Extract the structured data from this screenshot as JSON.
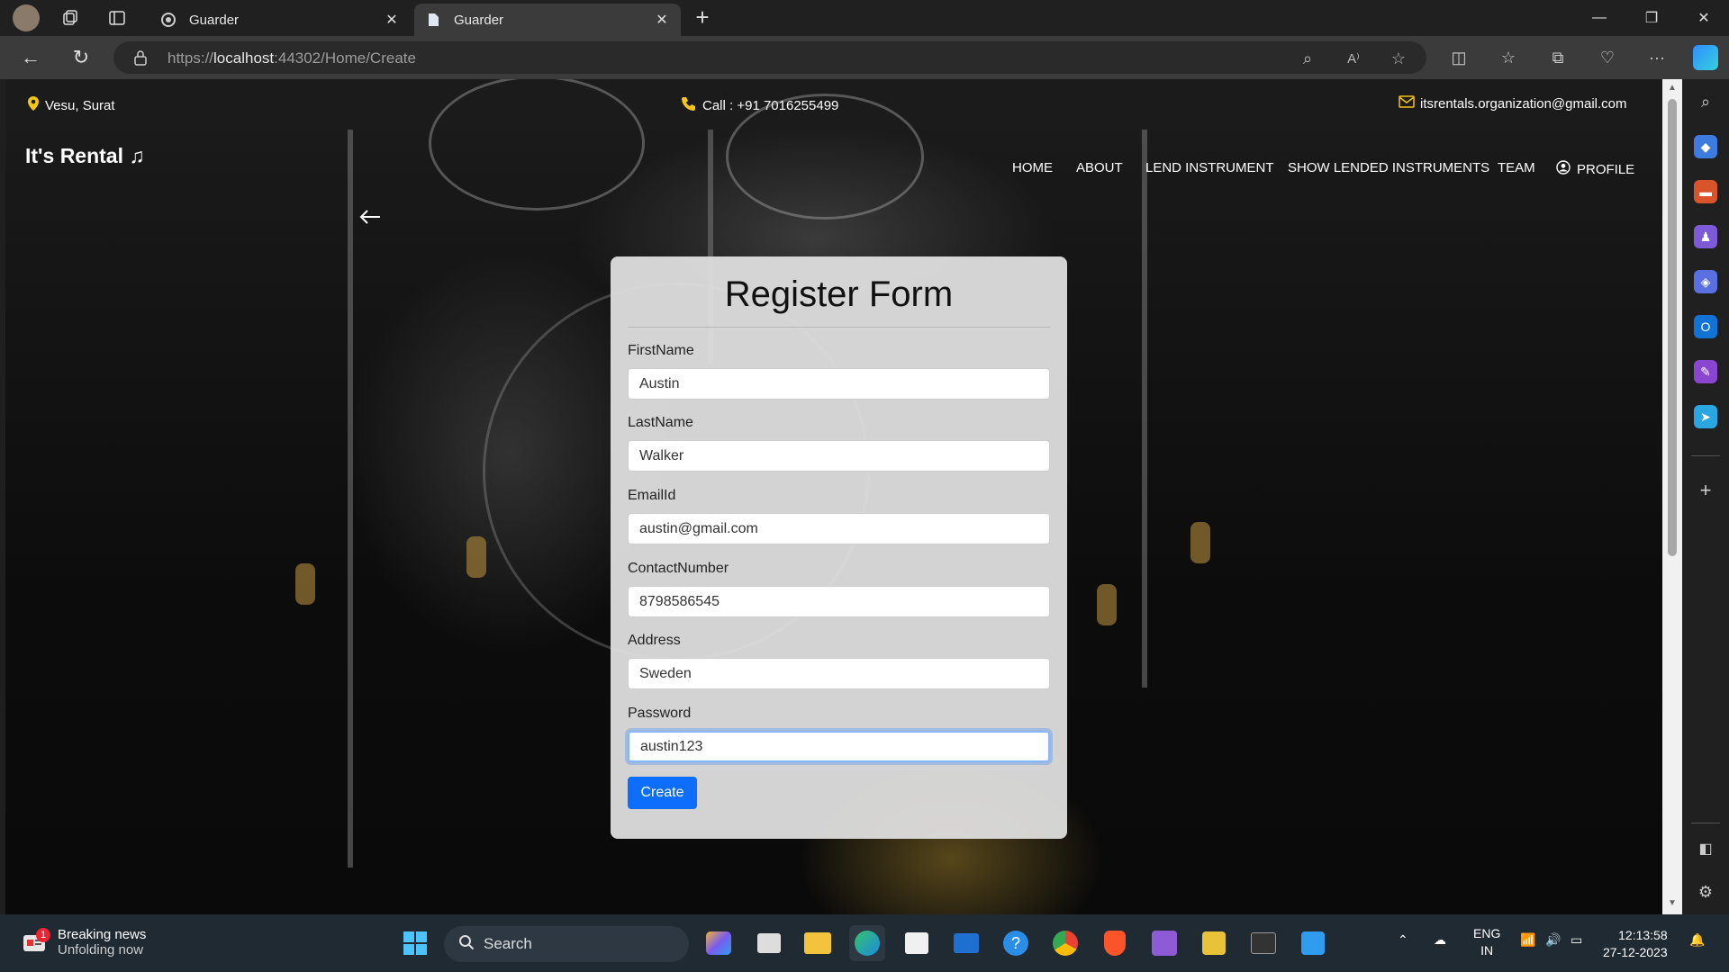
{
  "browser": {
    "tabs": [
      {
        "title": "Guarder",
        "active": false
      },
      {
        "title": "Guarder",
        "active": true
      }
    ],
    "url_scheme": "https://",
    "url_host": "localhost",
    "url_rest": ":44302/Home/Create"
  },
  "infobar": {
    "location": "Vesu, Surat",
    "call": "Call : +91 7016255499",
    "email": "itsrentals.organization@gmail.com"
  },
  "site": {
    "brand": "It's Rental ♫",
    "menu": [
      {
        "label": "HOME"
      },
      {
        "label": "ABOUT"
      },
      {
        "label": "LEND INSTRUMENT"
      },
      {
        "label": "SHOW LENDED INSTRUMENTS"
      },
      {
        "label": "TEAM"
      },
      {
        "label": "PROFILE"
      }
    ]
  },
  "form": {
    "title": "Register Form",
    "fields": [
      {
        "label": "FirstName",
        "value": "Austin"
      },
      {
        "label": "LastName",
        "value": "Walker"
      },
      {
        "label": "EmailId",
        "value": "austin@gmail.com"
      },
      {
        "label": "ContactNumber",
        "value": "8798586545"
      },
      {
        "label": "Address",
        "value": "Sweden"
      },
      {
        "label": "Password",
        "value": "austin123"
      }
    ],
    "submit_label": "Create"
  },
  "taskbar": {
    "news_title": "Breaking news",
    "news_subtitle": "Unfolding now",
    "news_badge": "1",
    "search_placeholder": "Search",
    "lang_line1": "ENG",
    "lang_line2": "IN",
    "time": "12:13:58",
    "date": "27-12-2023"
  },
  "colors": {
    "primary_button": "#0d6efd",
    "card_bg": "#dedede",
    "infobar_bg": "#1b1b1b",
    "taskbar_bg": "#202a33"
  }
}
